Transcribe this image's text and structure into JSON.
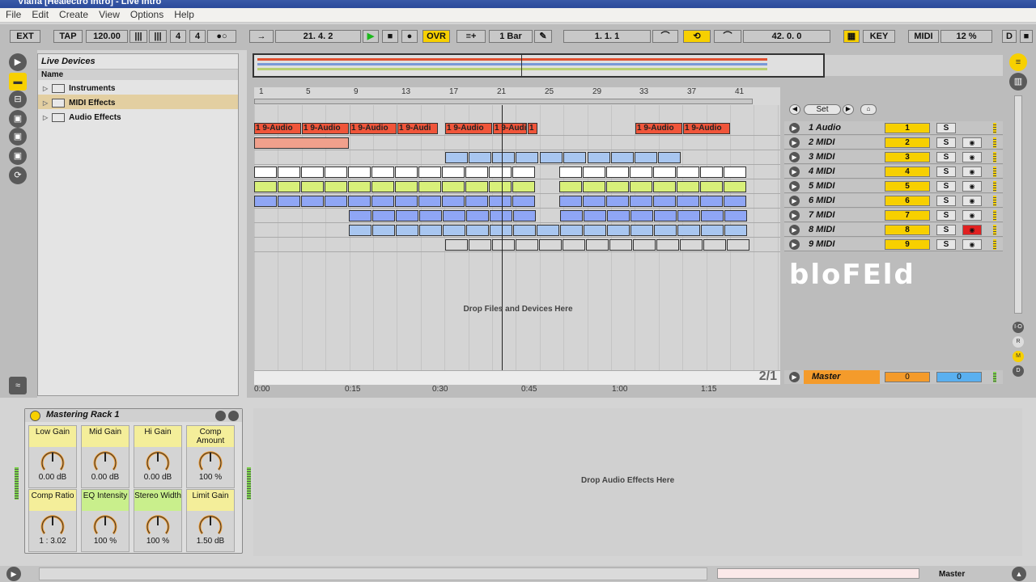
{
  "window": {
    "title": "Vlaffa  [Healectro Intro] - Live Intro"
  },
  "menu": [
    "File",
    "Edit",
    "Create",
    "View",
    "Options",
    "Help"
  ],
  "control": {
    "ext": "EXT",
    "tap": "TAP",
    "tempo": "120.00",
    "meter_num": "4",
    "meter_den": "4",
    "follow": "→",
    "position": "21.   4.   2",
    "ovr": "OVR",
    "quant": "1 Bar",
    "loop_start": "1.   1.   1",
    "loop_len": "42.   0.   0",
    "key": "KEY",
    "midi": "MIDI",
    "cpu": "12 %",
    "disk": "D"
  },
  "browser": {
    "title": "Live Devices",
    "col_header": "Name",
    "items": [
      {
        "label": "Instruments"
      },
      {
        "label": "MIDI Effects"
      },
      {
        "label": "Audio Effects"
      }
    ]
  },
  "ruler": {
    "ticks": [
      "1",
      "5",
      "9",
      "13",
      "17",
      "21",
      "25",
      "29",
      "33",
      "37",
      "41"
    ]
  },
  "time_labels": [
    "0:00",
    "0:15",
    "0:30",
    "0:45",
    "1:00",
    "1:15"
  ],
  "arrangement": {
    "drop_text": "Drop Files and Devices Here",
    "clip_label": "1 9-Audio",
    "clip_label_short": "1 9-Audi",
    "clip_label_end": "1",
    "page": "2/1"
  },
  "set_label": "Set",
  "tracks": [
    {
      "name": "1 Audio",
      "num": "1",
      "solo": "S",
      "arm": ""
    },
    {
      "name": "2 MIDI",
      "num": "2",
      "solo": "S",
      "arm": "◉"
    },
    {
      "name": "3 MIDI",
      "num": "3",
      "solo": "S",
      "arm": "◉"
    },
    {
      "name": "4 MIDI",
      "num": "4",
      "solo": "S",
      "arm": "◉"
    },
    {
      "name": "5 MIDI",
      "num": "5",
      "solo": "S",
      "arm": "◉"
    },
    {
      "name": "6 MIDI",
      "num": "6",
      "solo": "S",
      "arm": "◉"
    },
    {
      "name": "7 MIDI",
      "num": "7",
      "solo": "S",
      "arm": "◉"
    },
    {
      "name": "8 MIDI",
      "num": "8",
      "solo": "S",
      "arm": "◉"
    },
    {
      "name": "9 MIDI",
      "num": "9",
      "solo": "S",
      "arm": "◉"
    }
  ],
  "master": {
    "name": "Master",
    "vol": "0",
    "pan": "0"
  },
  "logo_text": "bloFEld",
  "rack": {
    "title": "Mastering Rack 1",
    "knobs": [
      {
        "label": "Low Gain",
        "value": "0.00 dB",
        "green": false
      },
      {
        "label": "Mid Gain",
        "value": "0.00 dB",
        "green": false
      },
      {
        "label": "Hi Gain",
        "value": "0.00 dB",
        "green": false
      },
      {
        "label": "Comp Amount",
        "value": "100 %",
        "green": false
      },
      {
        "label": "Comp Ratio",
        "value": "1 : 3.02",
        "green": false
      },
      {
        "label": "EQ Intensity",
        "value": "100 %",
        "green": true
      },
      {
        "label": "Stereo Width",
        "value": "100 %",
        "green": true
      },
      {
        "label": "Limit Gain",
        "value": "1.50 dB",
        "green": false
      }
    ]
  },
  "fx_drop": "Drop Audio Effects Here",
  "status": {
    "master_label": "Master"
  },
  "colors": {
    "clip_red": "#f0553a",
    "clip_salmon": "#f0a08c",
    "clip_blue": "#a8c6f0",
    "clip_white": "#ffffff",
    "clip_lime": "#d8f07a",
    "clip_periwinkle": "#8fa6f5",
    "accent": "#f7d000"
  }
}
